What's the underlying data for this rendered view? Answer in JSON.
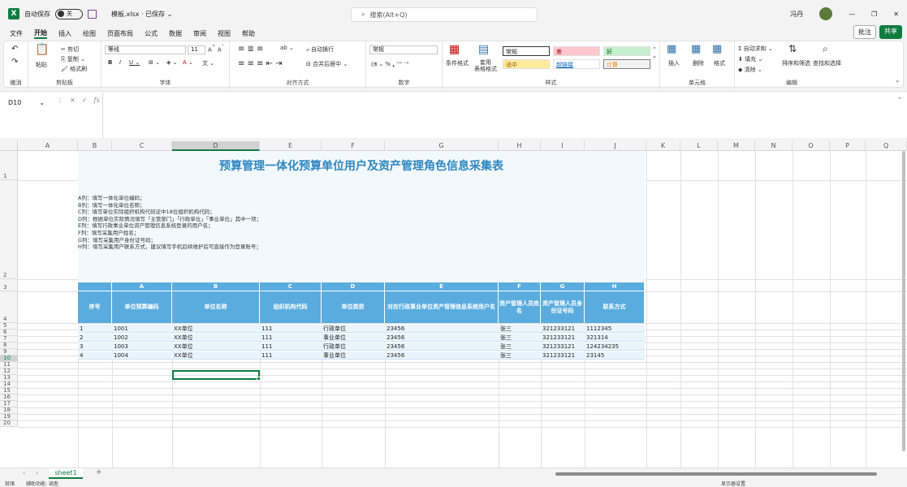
{
  "titlebar": {
    "autosave_label": "自动保存",
    "autosave_state": "关",
    "filename": "模板.xlsx · 已保存 ⌄",
    "search_placeholder": "搜索(Alt+Q)",
    "user_name": "冯丹"
  },
  "menu": {
    "items": [
      "文件",
      "开始",
      "插入",
      "绘图",
      "页面布局",
      "公式",
      "数据",
      "审阅",
      "视图",
      "帮助"
    ],
    "comment_label": "批注",
    "share_label": "共享"
  },
  "ribbon": {
    "clipboard": {
      "label": "剪贴板",
      "paste": "粘贴",
      "cut": "剪切",
      "copy": "复制 ⌄",
      "format_painter": "格式刷",
      "undo_label": "撤消"
    },
    "font": {
      "label": "字体",
      "font_name": "等线",
      "font_size": "11"
    },
    "alignment": {
      "label": "对齐方式",
      "wrap": "自动换行",
      "merge": "合并后居中 ⌄"
    },
    "number": {
      "label": "数字",
      "format": "常规"
    },
    "styles": {
      "label": "样式",
      "conditional": "条件格式",
      "table": "套用\n表格格式",
      "normal": "常规",
      "bad": "差",
      "good": "好",
      "neutral": "适中",
      "hyperlink": "超链接",
      "calc": "计算"
    },
    "cells": {
      "label": "单元格",
      "insert": "插入",
      "delete": "删除",
      "format": "格式"
    },
    "editing": {
      "label": "编辑",
      "autosum": "自动求和 ⌄",
      "fill": "填充 ⌄",
      "clear": "清除 ⌄",
      "sort": "排序和筛选",
      "find": "查找和选择"
    }
  },
  "formula_bar": {
    "name_box": "D10",
    "fx": "fx",
    "content": ""
  },
  "columns": [
    "A",
    "B",
    "C",
    "D",
    "E",
    "F",
    "G",
    "H",
    "I",
    "J",
    "K",
    "L",
    "M",
    "N",
    "O",
    "P",
    "Q"
  ],
  "rows": [
    "1",
    "2",
    "3",
    "4",
    "5",
    "6",
    "7",
    "8",
    "9",
    "10",
    "11",
    "12",
    "13",
    "14",
    "15",
    "16",
    "17",
    "18",
    "19",
    "20"
  ],
  "sheet": {
    "title": "预算管理一体化预算单位用户及资产管理角色信息采集表",
    "notes": [
      "A列：填写一体化单位编码；",
      "B列：填写一体化单位名称；",
      "C列：填写单位实际组织机构代码证中18位组织机构代码；",
      "D列：根据单位实际情况填写「主管部门」「行政单位」「事业单位」其中一项；",
      "E列：填写行政事业单位资产管理信息系统登录的用户名；",
      "F列：填写采集用户姓名；",
      "G列：填写采集用户身份证号码；",
      "H列：填写采集用户联系方式，建议填写手机后续维护后可直接作为登录账号；"
    ],
    "letter_row": [
      "",
      "A",
      "B",
      "C",
      "D",
      "E",
      "F",
      "G",
      "H"
    ],
    "headers": [
      "序号",
      "单位预算编码",
      "单位名称",
      "组织机构代码",
      "单位类型",
      "对应行政事业单位资产管理信息系统用户名",
      "资产管理人员姓名",
      "资产管理人员身份证号码",
      "联系方式"
    ],
    "data": [
      [
        "1",
        "1001",
        "XX单位",
        "111",
        "行政单位",
        "23456",
        "张三",
        "321233121",
        "1112345"
      ],
      [
        "2",
        "1002",
        "XX单位",
        "111",
        "事业单位",
        "23456",
        "张三",
        "321233121",
        "321314"
      ],
      [
        "3",
        "1003",
        "XX单位",
        "111",
        "行政单位",
        "23456",
        "张三",
        "321233121",
        "124234235"
      ],
      [
        "4",
        "1004",
        "XX单位",
        "111",
        "事业单位",
        "23456",
        "张三",
        "321233121",
        "23145"
      ]
    ]
  },
  "tabs": {
    "sheet_name": "sheet1",
    "add": "+"
  },
  "statusbar": {
    "ready": "就绪",
    "accessibility": "辅助功能: 调查",
    "display_settings": "显示器设置"
  }
}
